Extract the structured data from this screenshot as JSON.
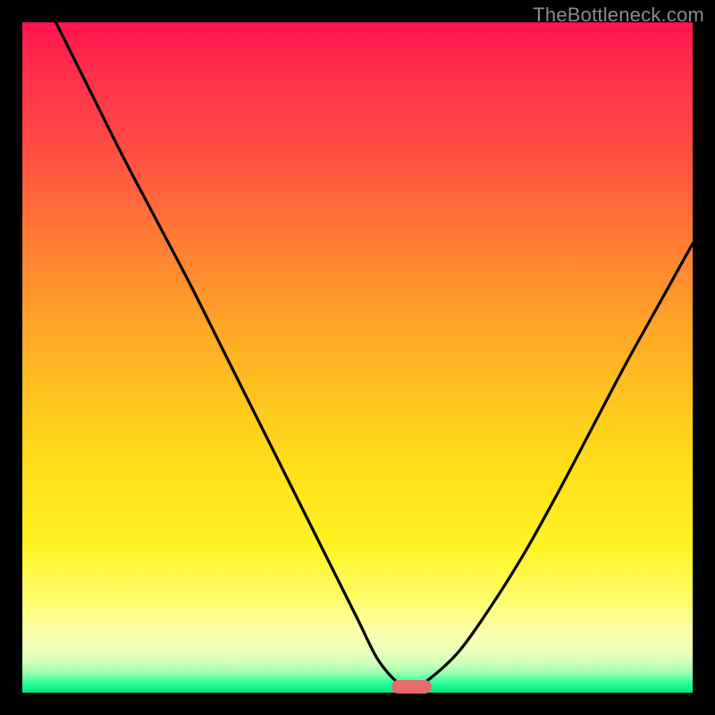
{
  "watermark": "TheBottleneck.com",
  "chart_data": {
    "type": "line",
    "title": "",
    "xlabel": "",
    "ylabel": "",
    "xlim": [
      0,
      100
    ],
    "ylim": [
      0,
      100
    ],
    "grid": false,
    "legend": false,
    "series": [
      {
        "name": "bottleneck-curve",
        "x": [
          5,
          10,
          15,
          20,
          25,
          30,
          35,
          40,
          45,
          50,
          53,
          56,
          58,
          60,
          65,
          70,
          75,
          80,
          85,
          90,
          95,
          100
        ],
        "y": [
          100,
          90,
          80,
          70.5,
          61,
          51,
          41,
          31,
          21,
          11,
          5,
          1.5,
          1,
          1.5,
          6,
          13,
          21,
          30,
          39.5,
          49,
          58,
          67
        ]
      }
    ],
    "marker": {
      "x_center": 58,
      "y": 1,
      "width": 6,
      "color": "#e76a6d"
    },
    "background_gradient_stops": [
      {
        "pos": 0,
        "color": "#ff1450"
      },
      {
        "pos": 0.45,
        "color": "#ffa428"
      },
      {
        "pos": 0.78,
        "color": "#fff223"
      },
      {
        "pos": 0.96,
        "color": "#c4ffb7"
      },
      {
        "pos": 1.0,
        "color": "#00e884"
      }
    ]
  }
}
